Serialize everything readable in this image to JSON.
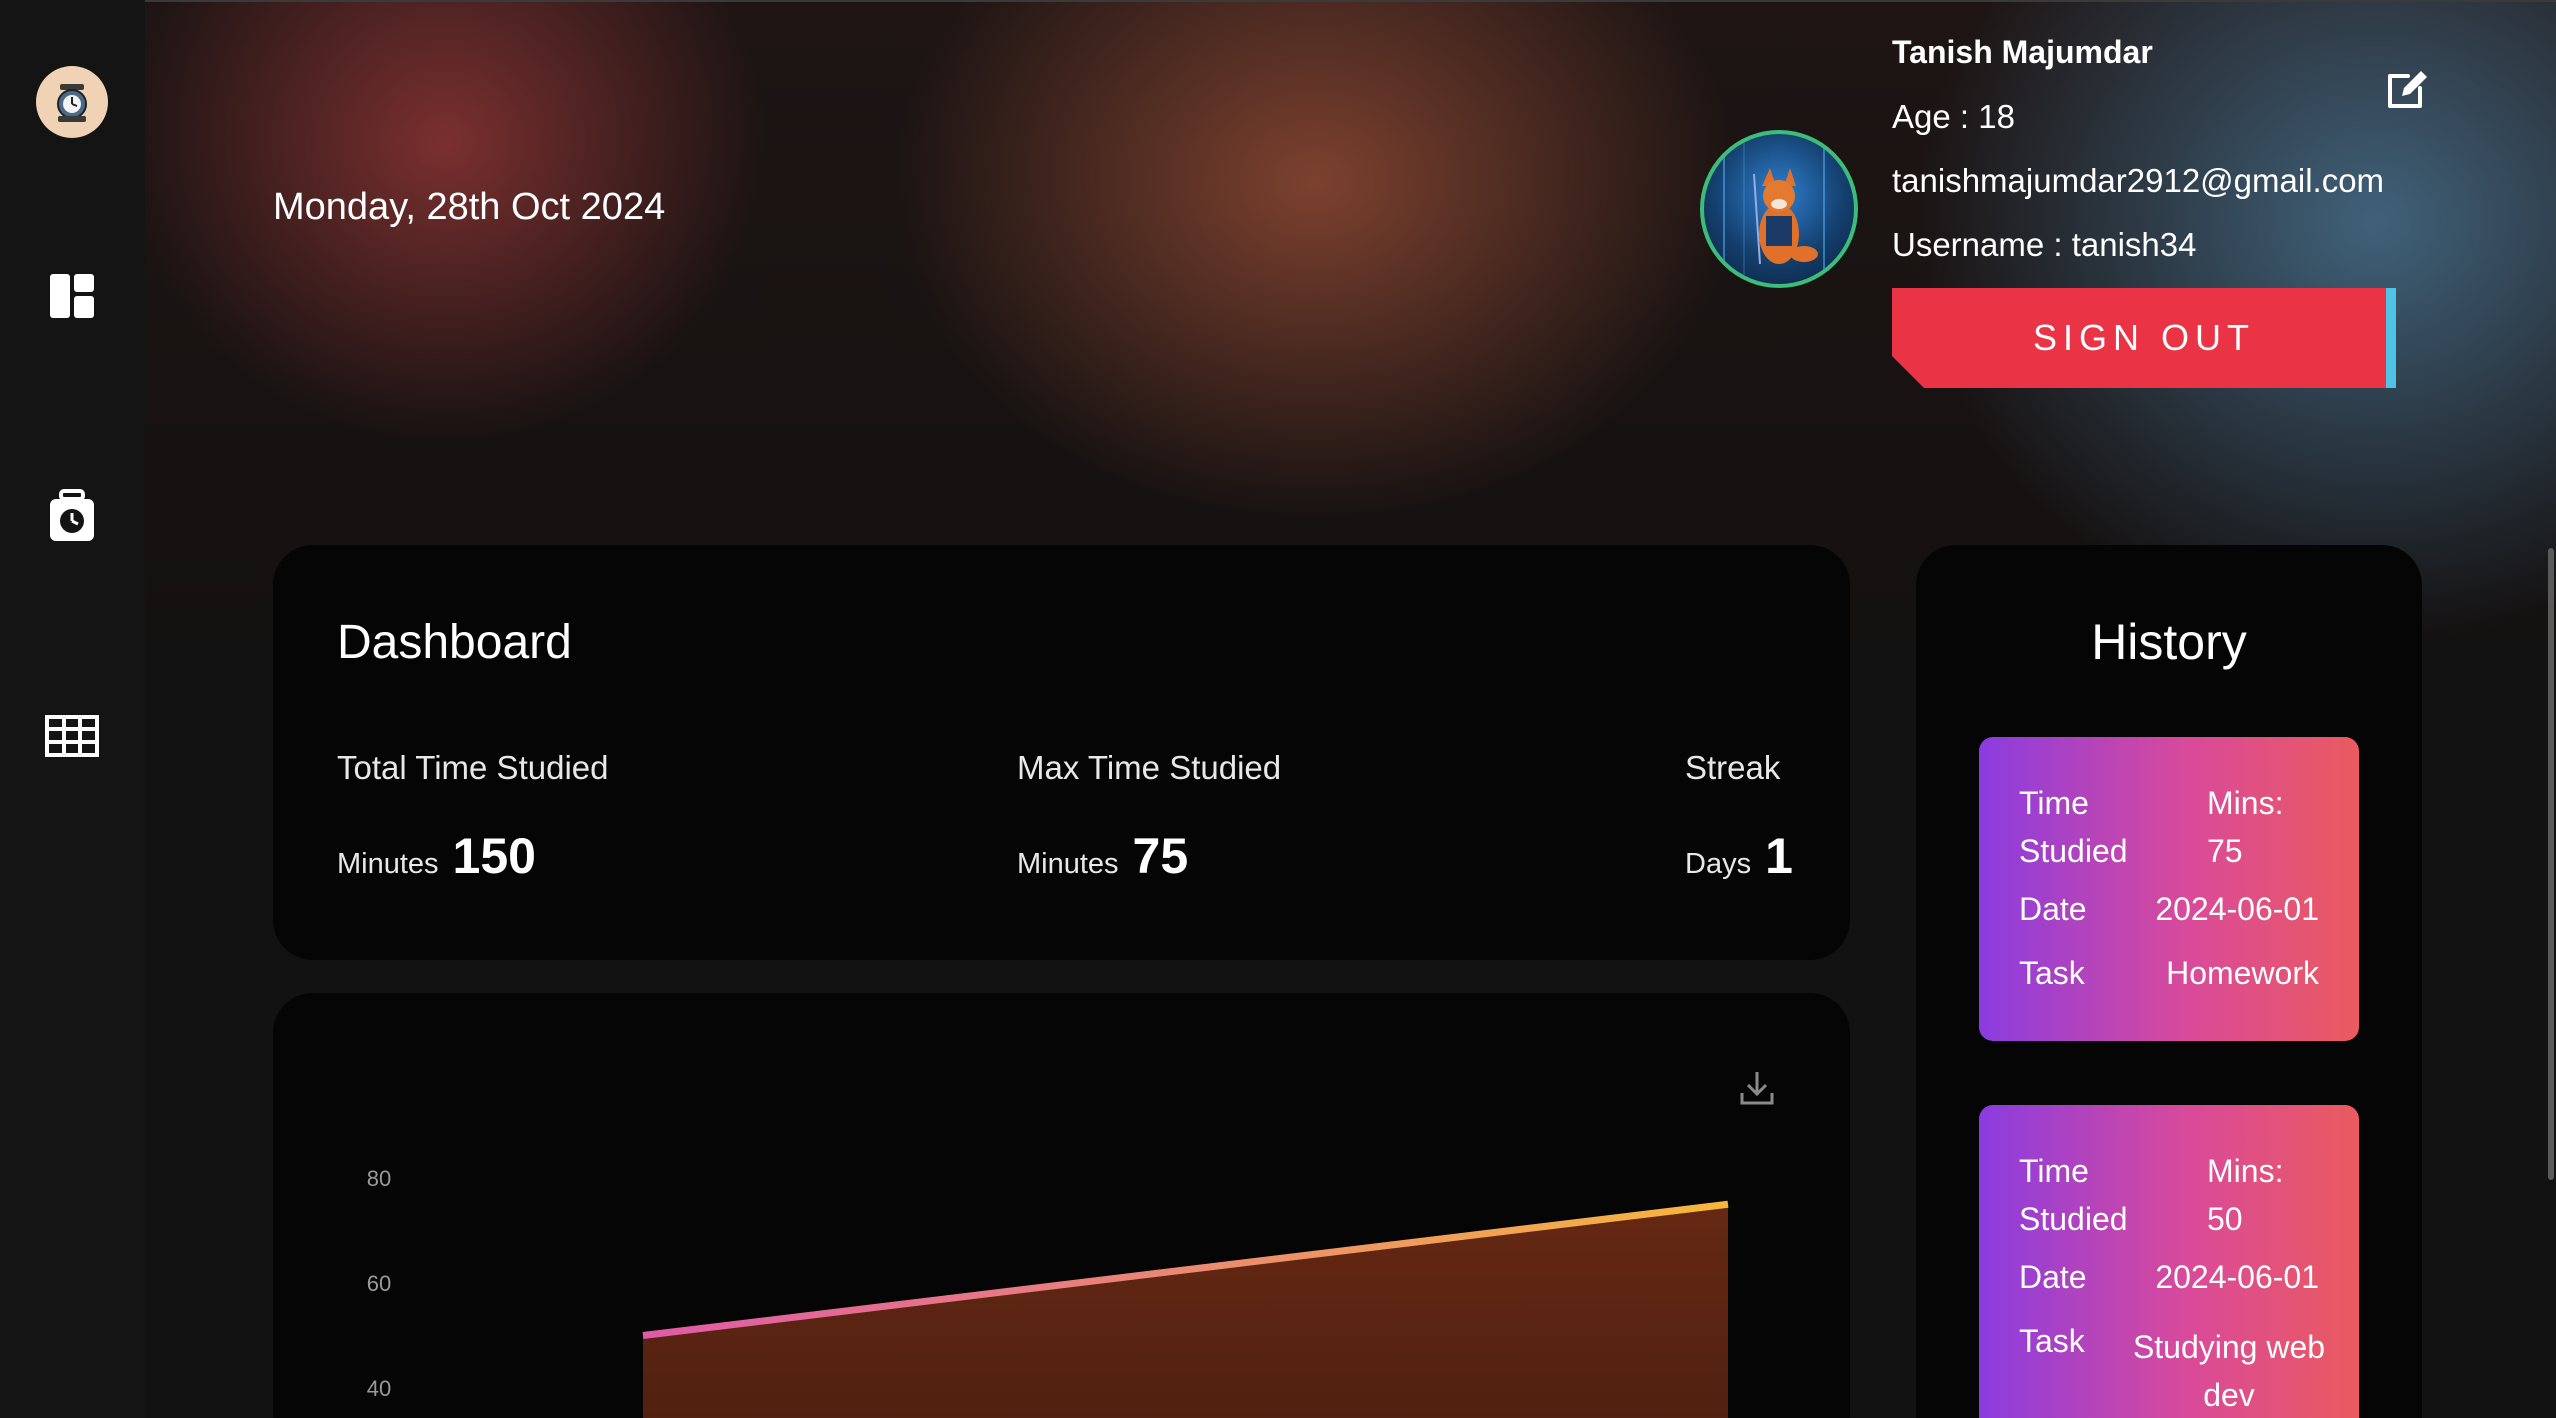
{
  "header": {
    "date": "Monday, 28th Oct 2024"
  },
  "profile": {
    "name": "Tanish Majumdar",
    "age": "Age : 18",
    "email": "tanishmajumdar2912@gmail.com",
    "username": "Username : tanish34",
    "signout_label": "SIGN OUT"
  },
  "dashboard": {
    "title": "Dashboard",
    "stats": [
      {
        "label": "Total Time Studied",
        "unit": "Minutes",
        "value": "150"
      },
      {
        "label": "Max Time Studied",
        "unit": "Minutes",
        "value": "75"
      },
      {
        "label": "Streak",
        "unit": "Days",
        "value": "1"
      }
    ]
  },
  "chart_data": {
    "type": "area",
    "y_ticks": [
      "80",
      "60",
      "40"
    ],
    "ylim": [
      0,
      80
    ],
    "x": [
      0,
      1
    ],
    "values": [
      50,
      75
    ],
    "colors": {
      "line_start": "#e05aa8",
      "line_end": "#f6b73c",
      "fill": "#6b2a14"
    }
  },
  "history": {
    "title": "History",
    "entries": [
      {
        "time_label": "Time Studied",
        "time_value": "Mins: 75",
        "date_label": "Date",
        "date_value": "2024-06-01",
        "task_label": "Task",
        "task_value": "Homework"
      },
      {
        "time_label": "Time Studied",
        "time_value": "Mins: 50",
        "date_label": "Date",
        "date_value": "2024-06-01",
        "task_label": "Task",
        "task_value": "Studying web dev"
      }
    ]
  },
  "sidebar": {
    "icons": [
      "app-logo-icon",
      "dashboard-icon",
      "timer-icon",
      "table-icon"
    ]
  },
  "colors": {
    "signout": "#ea3445",
    "accent_cyan": "#4fc3e6",
    "history_gradient_start": "#8a3ce0",
    "history_gradient_end": "#ea5a5e"
  }
}
